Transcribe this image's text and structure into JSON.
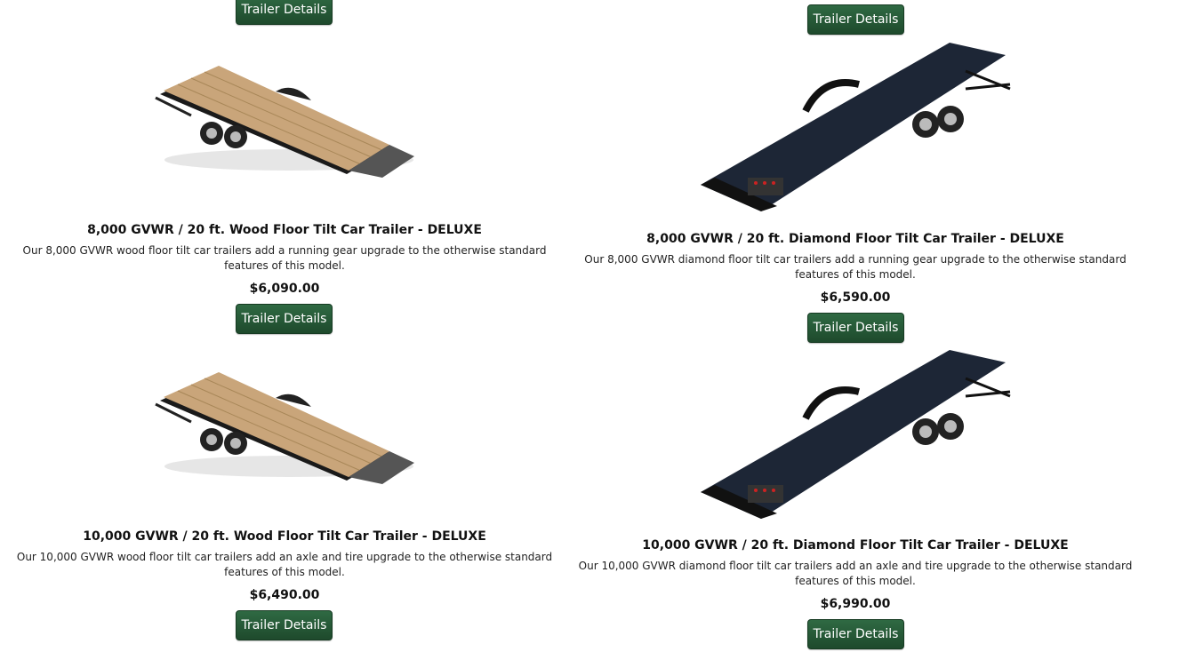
{
  "button_label": "Trailer Details",
  "products": [
    {
      "title": "8,000 GVWR / 20 ft. Wood Floor Tilt Car Trailer - DELUXE",
      "description": "Our 8,000 GVWR wood floor tilt car trailers add a running gear upgrade to the otherwise standard features of this model.",
      "price": "$6,090.00",
      "image": "wood-floor-trailer-icon"
    },
    {
      "title": "8,000 GVWR / 20 ft. Diamond Floor Tilt Car Trailer - DELUXE",
      "description": "Our 8,000 GVWR diamond floor tilt car trailers add a running gear upgrade to the otherwise standard features of this model.",
      "price": "$6,590.00",
      "image": "diamond-floor-trailer-icon"
    },
    {
      "title": "10,000 GVWR / 20 ft. Wood Floor Tilt Car Trailer - DELUXE",
      "description": "Our 10,000 GVWR wood floor tilt car trailers add an axle and tire upgrade to the otherwise standard features of this model.",
      "price": "$6,490.00",
      "image": "wood-floor-trailer-icon"
    },
    {
      "title": "10,000 GVWR / 20 ft. Diamond Floor Tilt Car Trailer - DELUXE",
      "description": "Our 10,000 GVWR diamond floor tilt car trailers add an axle and tire upgrade to the otherwise standard features of this model.",
      "price": "$6,990.00",
      "image": "diamond-floor-trailer-icon"
    }
  ],
  "colors": {
    "button_bg": "#24543a",
    "wood_deck": "#c8a878",
    "diamond_deck": "#1c2433"
  }
}
